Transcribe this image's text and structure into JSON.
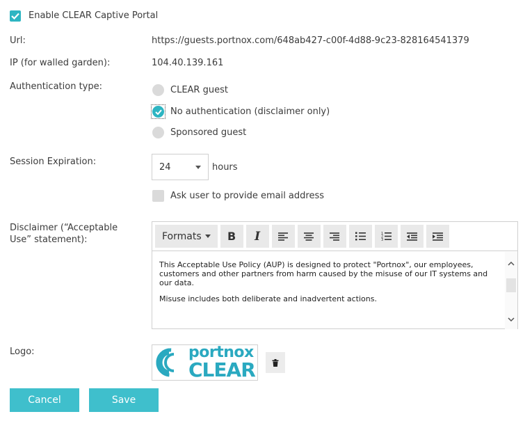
{
  "enable_portal": {
    "label": "Enable CLEAR Captive Portal",
    "checked": true
  },
  "url": {
    "label": "Url:",
    "value": "https://guests.portnox.com/648ab427-c00f-4d88-9c23-828164541379"
  },
  "ip": {
    "label": "IP (for walled garden):",
    "value": "104.40.139.161"
  },
  "auth": {
    "label": "Authentication type:",
    "options": [
      {
        "label": "CLEAR guest",
        "selected": false
      },
      {
        "label": "No authentication (disclaimer only)",
        "selected": true
      },
      {
        "label": "Sponsored guest",
        "selected": false
      }
    ]
  },
  "session": {
    "label": "Session Expiration:",
    "value": "24",
    "unit": "hours",
    "ask_email_label": "Ask user to provide email address",
    "ask_email_checked": false
  },
  "disclaimer": {
    "label_line1": "Disclaimer (“Acceptable",
    "label_line2": "Use” statement):",
    "toolbar": {
      "formats": "Formats",
      "bold": "B",
      "italic": "I"
    },
    "paragraph1": "This Acceptable Use Policy (AUP) is designed to protect \"Portnox\", our employees, customers and other partners from harm caused by the misuse of our IT systems and our data.",
    "paragraph2": "Misuse includes both deliberate and inadvertent actions."
  },
  "logo": {
    "label": "Logo:",
    "text_top": "portnox",
    "text_bottom": "CLEAR"
  },
  "buttons": {
    "cancel": "Cancel",
    "save": "Save"
  },
  "colors": {
    "accent": "#2eb5c2",
    "button": "#3fbfcc",
    "logo": "#2aa9c0"
  }
}
